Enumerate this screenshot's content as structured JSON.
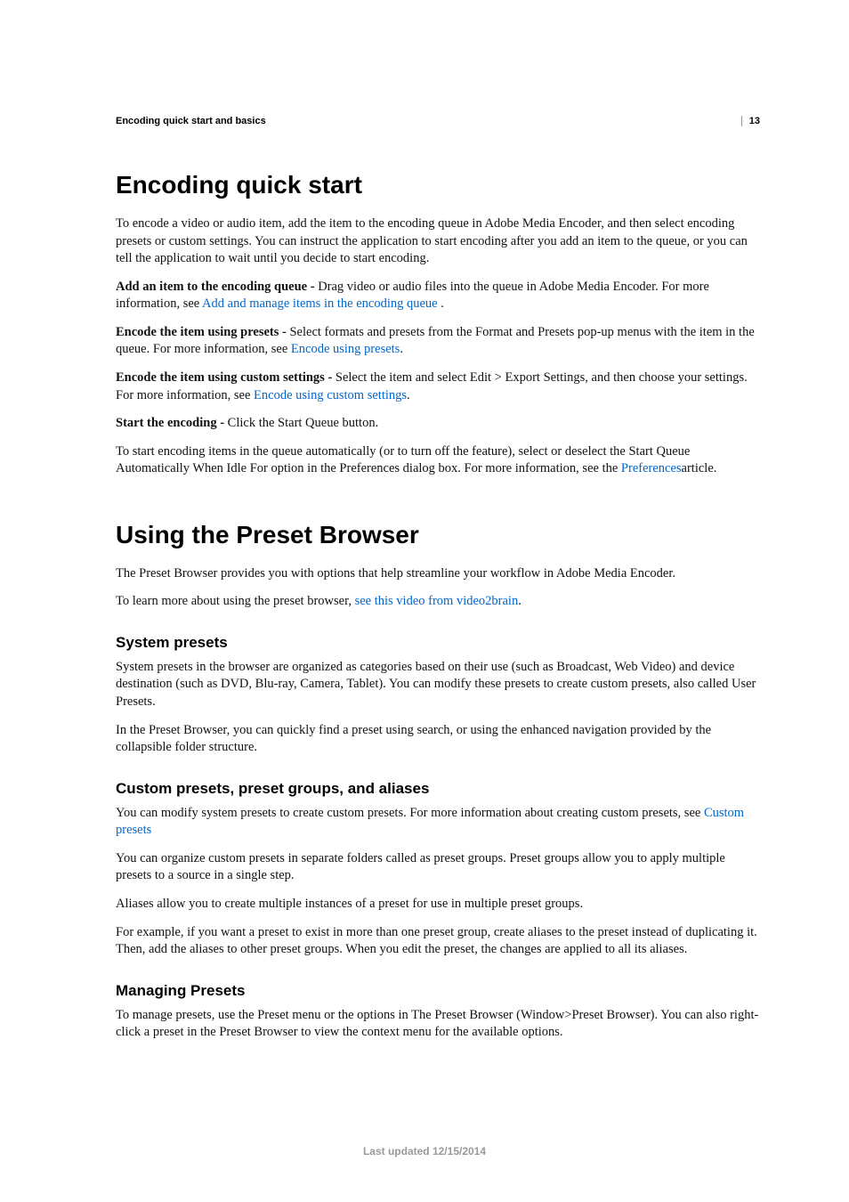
{
  "page_number": "13",
  "header": "Encoding quick start and basics",
  "s1": {
    "title": "Encoding quick start",
    "p1": "To encode a video or audio item, add the item to the encoding queue in Adobe Media Encoder, and then select encoding presets or custom settings. You can instruct the application to start encoding after you add an item to the queue, or you can tell the application to wait until you decide to start encoding.",
    "p2a": "Add an item to the encoding queue - ",
    "p2b": "Drag video or audio files into the queue in Adobe Media Encoder. For more information, see ",
    "p2link": "Add and manage items in the encoding queue ",
    "p2c": ".",
    "p3a": "Encode the item using presets - ",
    "p3b": "Select formats and presets from the Format and Presets pop-up menus with the item in the queue. For more information, see ",
    "p3link": "Encode using presets",
    "p3c": ".",
    "p4a": "Encode the item using custom settings - ",
    "p4b": "Select the item and select Edit > Export Settings, and then choose your settings. For more information, see ",
    "p4link": "Encode using custom settings",
    "p4c": ".",
    "p5a": "Start the encoding - ",
    "p5b": "Click the Start Queue button.",
    "p6a": "To start encoding items in the queue automatically (or to turn off the feature), select or deselect the Start Queue Automatically When Idle For option in the Preferences dialog box. For more information, see the ",
    "p6link": "Preferences",
    "p6b": "article."
  },
  "s2": {
    "title": "Using the Preset Browser",
    "p1": "The Preset Browser provides you with options that help streamline your workflow in Adobe Media Encoder.",
    "p2a": "To learn more about using the preset browser, ",
    "p2link": "see this video from video2brain",
    "p2b": "."
  },
  "s3": {
    "title": "System presets",
    "p1": "System presets in the browser are organized as categories based on their use (such as Broadcast, Web Video) and device destination (such as DVD, Blu-ray, Camera, Tablet). You can modify these presets to create custom presets, also called User Presets.",
    "p2": "In the Preset Browser, you can quickly find a preset using search, or using the enhanced navigation provided by the collapsible folder structure."
  },
  "s4": {
    "title": "Custom presets, preset groups, and aliases",
    "p1a": "You can modify system presets to create custom presets. For more information about creating custom presets, see ",
    "p1link": "Custom presets",
    "p2": "You can organize custom presets in separate folders called as preset groups. Preset groups allow you to apply multiple presets to a source in a single step.",
    "p3": "Aliases allow you to create multiple instances of a preset for use in multiple preset groups.",
    "p4": "For example, if you want a preset to exist in more than one preset group, create aliases to the preset instead of duplicating it. Then, add the aliases to other preset groups. When you edit the preset, the changes are applied to all its aliases."
  },
  "s5": {
    "title": "Managing Presets",
    "p1": "To manage presets, use the Preset menu or the options in The Preset Browser (Window>Preset Browser). You can also right-click a preset in the Preset Browser to view the context menu for the available options."
  },
  "footer": "Last updated 12/15/2014"
}
